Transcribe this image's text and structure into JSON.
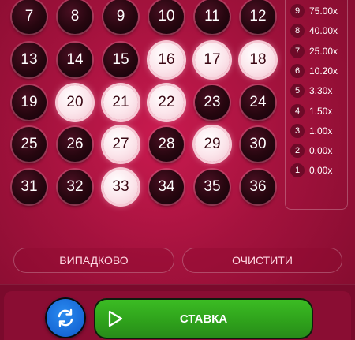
{
  "board": {
    "balls": [
      {
        "n": "7",
        "on": false
      },
      {
        "n": "8",
        "on": false
      },
      {
        "n": "9",
        "on": false
      },
      {
        "n": "10",
        "on": false
      },
      {
        "n": "11",
        "on": false
      },
      {
        "n": "12",
        "on": false
      },
      {
        "n": "13",
        "on": false
      },
      {
        "n": "14",
        "on": false
      },
      {
        "n": "15",
        "on": false
      },
      {
        "n": "16",
        "on": true
      },
      {
        "n": "17",
        "on": true
      },
      {
        "n": "18",
        "on": true
      },
      {
        "n": "19",
        "on": false
      },
      {
        "n": "20",
        "on": true
      },
      {
        "n": "21",
        "on": true
      },
      {
        "n": "22",
        "on": true
      },
      {
        "n": "23",
        "on": false
      },
      {
        "n": "24",
        "on": false
      },
      {
        "n": "25",
        "on": false
      },
      {
        "n": "26",
        "on": false
      },
      {
        "n": "27",
        "on": true
      },
      {
        "n": "28",
        "on": false
      },
      {
        "n": "29",
        "on": true
      },
      {
        "n": "30",
        "on": false
      },
      {
        "n": "31",
        "on": false
      },
      {
        "n": "32",
        "on": false
      },
      {
        "n": "33",
        "on": true
      },
      {
        "n": "34",
        "on": false
      },
      {
        "n": "35",
        "on": false
      },
      {
        "n": "36",
        "on": false
      }
    ]
  },
  "payout": [
    {
      "hits": "9",
      "mult": "75.00x"
    },
    {
      "hits": "8",
      "mult": "40.00x"
    },
    {
      "hits": "7",
      "mult": "25.00x"
    },
    {
      "hits": "6",
      "mult": "10.20x"
    },
    {
      "hits": "5",
      "mult": "3.30x"
    },
    {
      "hits": "4",
      "mult": "1.50x"
    },
    {
      "hits": "3",
      "mult": "1.00x"
    },
    {
      "hits": "2",
      "mult": "0.00x"
    },
    {
      "hits": "1",
      "mult": "0.00x"
    }
  ],
  "actions": {
    "random_label": "ВИПАДКОВО",
    "clear_label": "ОЧИСТИТИ"
  },
  "bet": {
    "label": "СТАВКА",
    "auto_icon": "autoplay-icon",
    "play_icon": "play-icon"
  },
  "colors": {
    "background": "#b3154a",
    "selected_ball": "#fbe4ea",
    "unselected_ball": "#26060f",
    "bet_button": "#2ea01b",
    "auto_button": "#1565d4"
  }
}
